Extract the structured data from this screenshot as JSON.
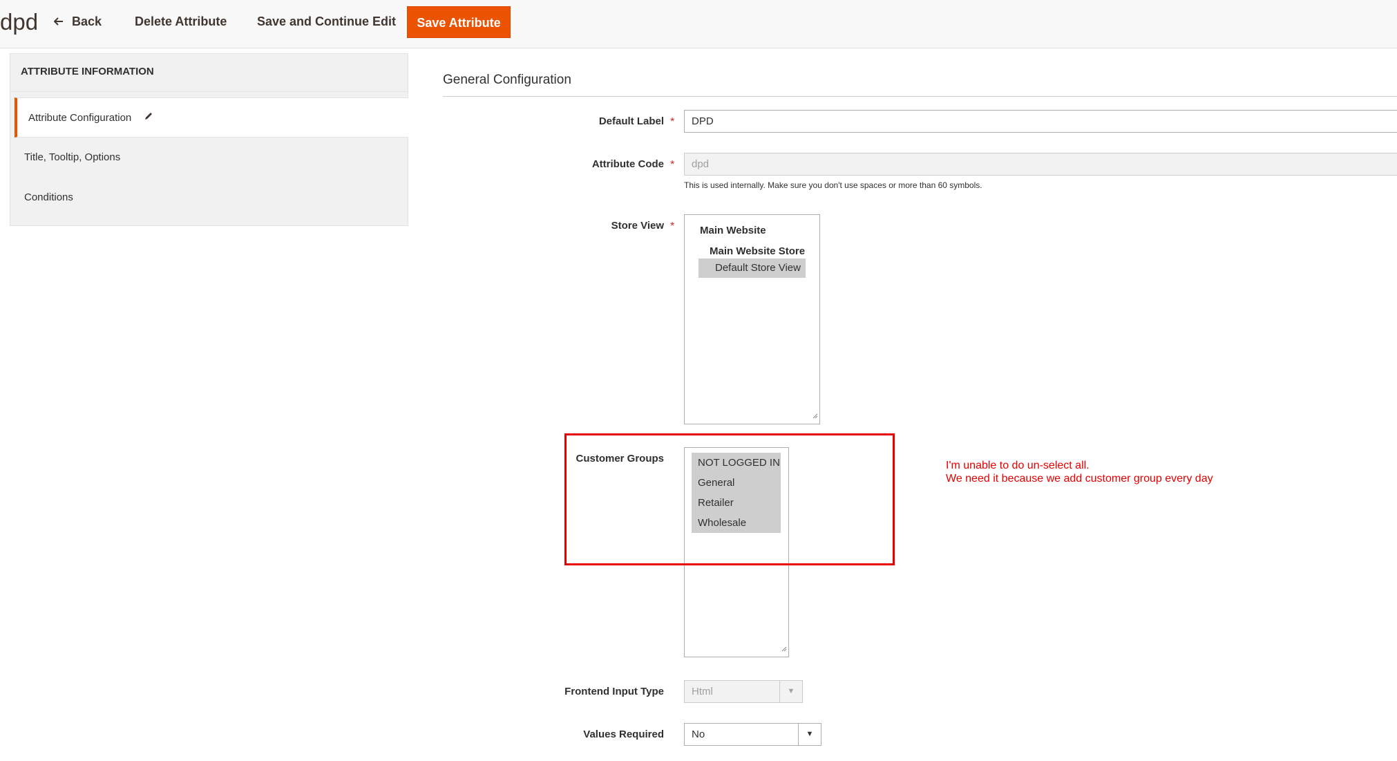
{
  "header": {
    "page_title": "dpd",
    "back_label": "Back",
    "delete_label": "Delete Attribute",
    "save_continue_label": "Save and Continue Edit",
    "save_label": "Save Attribute",
    "accent_color": "#eb5202"
  },
  "sidebar": {
    "title": "ATTRIBUTE INFORMATION",
    "items": [
      {
        "label": "Attribute Configuration",
        "active": true,
        "icon": "pencil-icon"
      },
      {
        "label": "Title, Tooltip, Options",
        "active": false
      },
      {
        "label": "Conditions",
        "active": false
      }
    ]
  },
  "main": {
    "section_title": "General Configuration",
    "default_label": {
      "label": "Default Label",
      "value": "DPD",
      "required": true
    },
    "attribute_code": {
      "label": "Attribute Code",
      "value": "dpd",
      "required": true,
      "disabled": true,
      "note": "This is used internally. Make sure you don't use spaces or more than 60 symbols."
    },
    "store_view": {
      "label": "Store View",
      "required": true,
      "website": "Main Website",
      "store": "Main Website Store",
      "view": "Default Store View",
      "selected": "Default Store View"
    },
    "customer_groups": {
      "label": "Customer Groups",
      "options": [
        "NOT LOGGED IN",
        "General",
        "Retailer",
        "Wholesale"
      ],
      "selected": [
        "NOT LOGGED IN",
        "General",
        "Retailer",
        "Wholesale"
      ]
    },
    "frontend_input_type": {
      "label": "Frontend Input Type",
      "value": "Html",
      "disabled": true
    },
    "values_required": {
      "label": "Values Required",
      "value": "No"
    }
  },
  "annotation": {
    "line1": "I'm unable to do un-select all.",
    "line2": "We need it because we add customer group every day",
    "color": "#e60000"
  }
}
